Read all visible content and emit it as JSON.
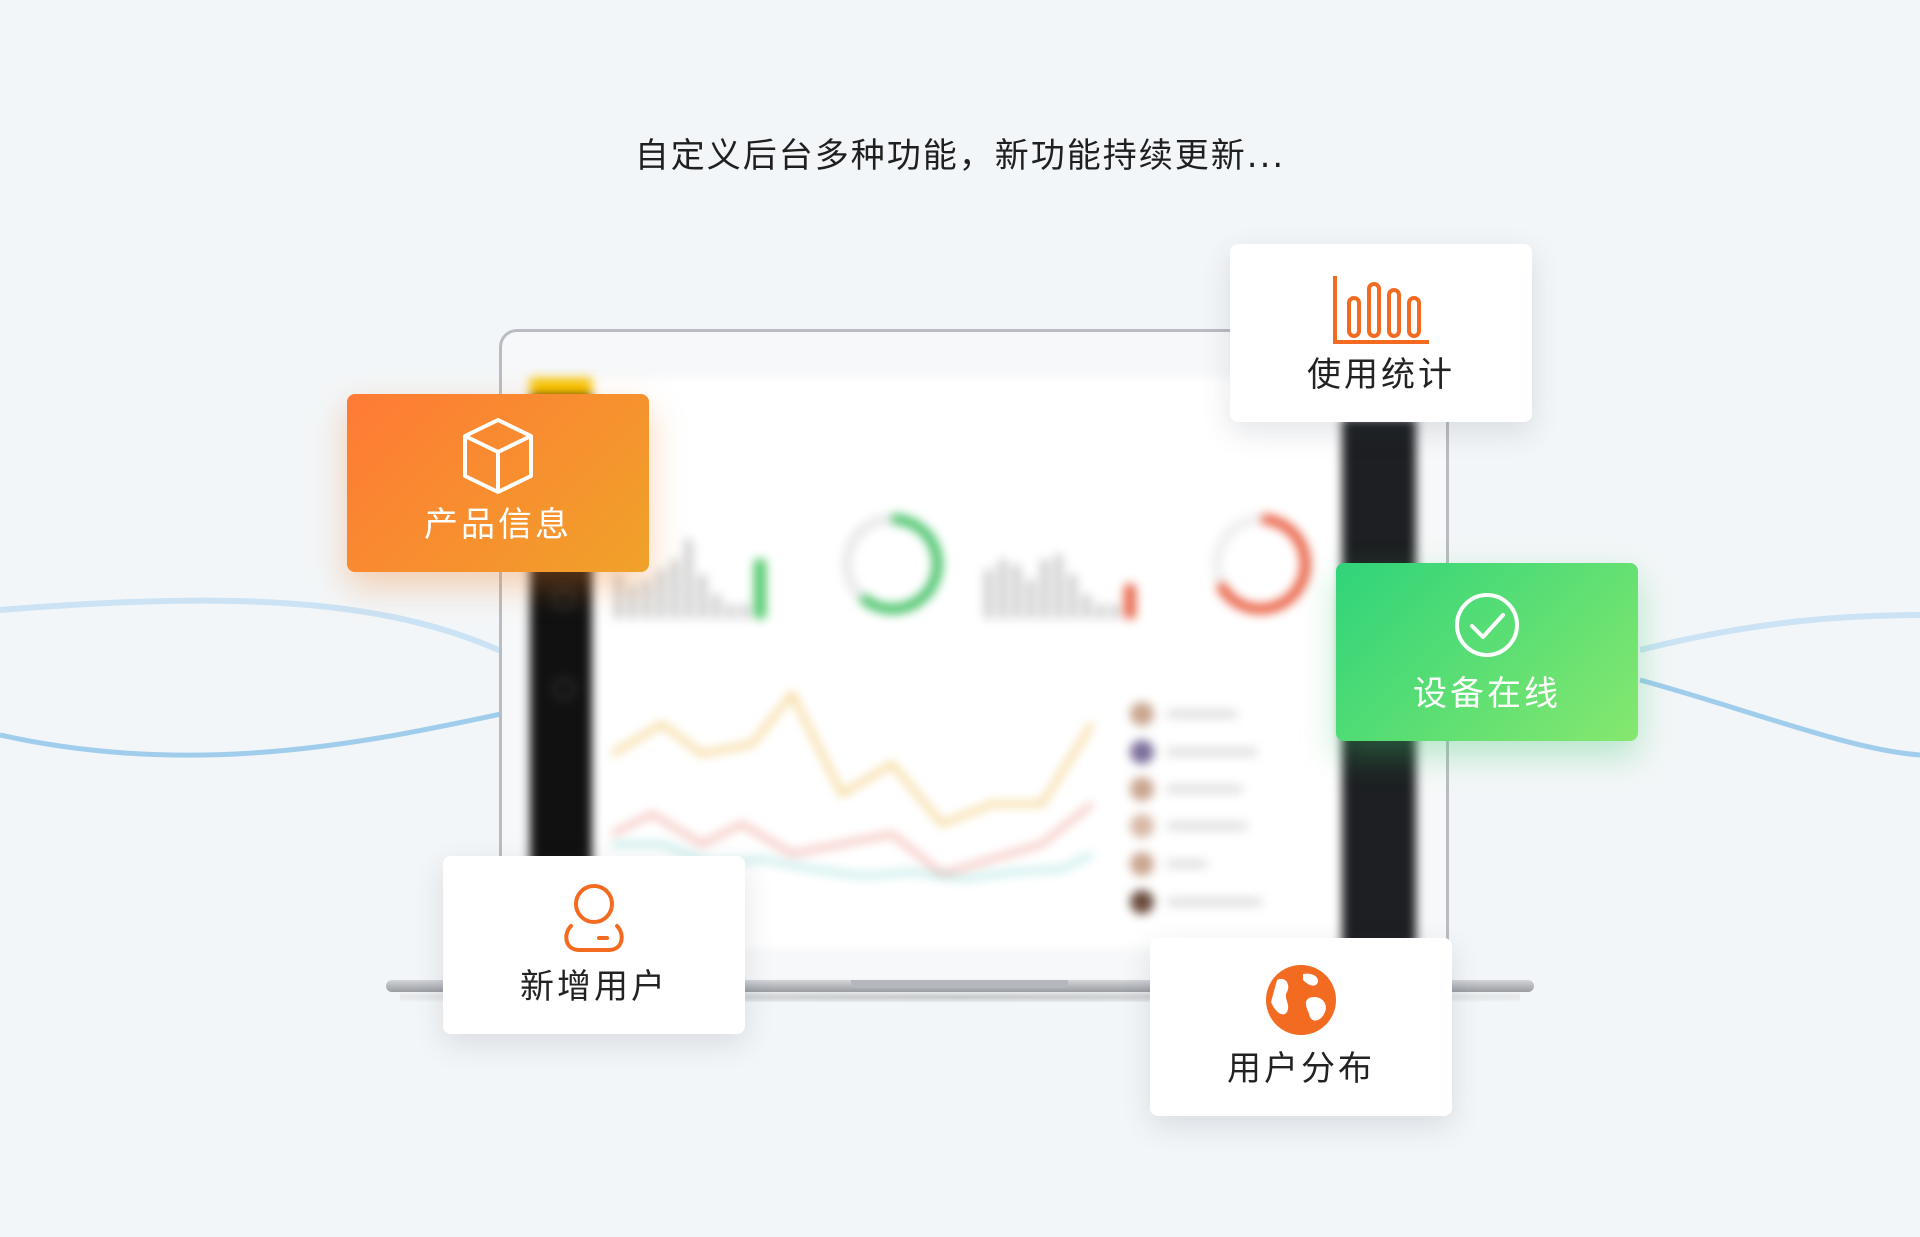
{
  "headline": "自定义后台多种功能，新功能持续更新...",
  "colors": {
    "accent_orange": "#f26b21",
    "card_orange": "#ff7a35",
    "card_green": "#3cd67a",
    "wave_blue": "#8cc3ea"
  },
  "features": {
    "product_info": {
      "label": "产品信息",
      "icon": "cube-icon"
    },
    "usage_stats": {
      "label": "使用统计",
      "icon": "bar-chart-icon"
    },
    "device_online": {
      "label": "设备在线",
      "icon": "check-circle-icon"
    },
    "new_users": {
      "label": "新增用户",
      "icon": "user-icon"
    },
    "user_distribution": {
      "label": "用户分布",
      "icon": "globe-icon"
    }
  }
}
